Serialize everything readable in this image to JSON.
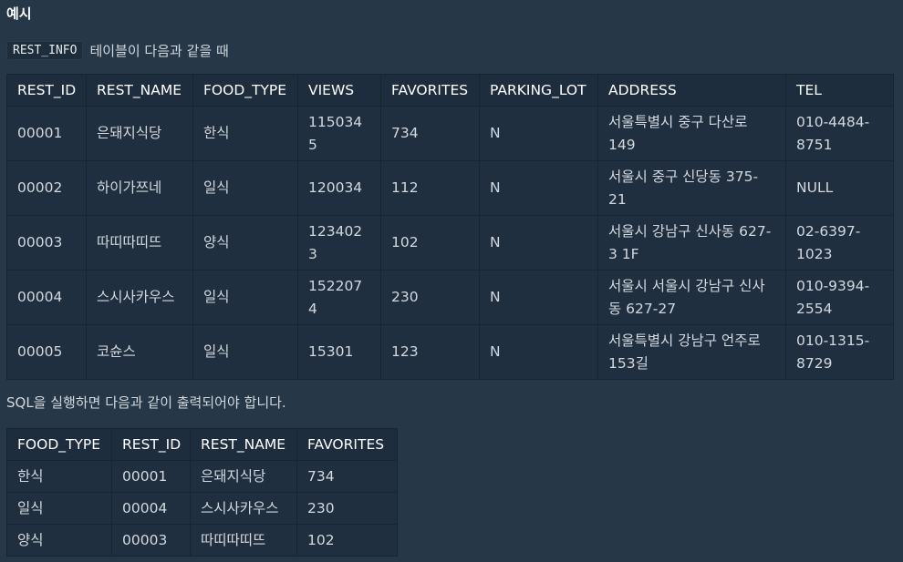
{
  "heading": "예시",
  "intro": {
    "table_name": "REST_INFO",
    "text": "테이블이 다음과 같을 때"
  },
  "table1": {
    "columns": [
      "REST_ID",
      "REST_NAME",
      "FOOD_TYPE",
      "VIEWS",
      "FAVORITES",
      "PARKING_LOT",
      "ADDRESS",
      "TEL"
    ],
    "rows": [
      [
        "00001",
        "은돼지식당",
        "한식",
        "1150345",
        "734",
        "N",
        "서울특별시 중구 다산로 149",
        "010-4484-8751"
      ],
      [
        "00002",
        "하이가쯔네",
        "일식",
        "120034",
        "112",
        "N",
        "서울시 중구 신당동 375-21",
        "NULL"
      ],
      [
        "00003",
        "따띠따띠뜨",
        "양식",
        "1234023",
        "102",
        "N",
        "서울시 강남구 신사동 627-3 1F",
        "02-6397-1023"
      ],
      [
        "00004",
        "스시사카우스",
        "일식",
        "1522074",
        "230",
        "N",
        "서울시 서울시 강남구 신사동 627-27",
        "010-9394-2554"
      ],
      [
        "00005",
        "코슌스",
        "일식",
        "15301",
        "123",
        "N",
        "서울특별시 강남구 언주로 153길",
        "010-1315-8729"
      ]
    ]
  },
  "result_text": "SQL을 실행하면 다음과 같이 출력되어야 합니다.",
  "table2": {
    "columns": [
      "FOOD_TYPE",
      "REST_ID",
      "REST_NAME",
      "FAVORITES"
    ],
    "rows": [
      [
        "한식",
        "00001",
        "은돼지식당",
        "734"
      ],
      [
        "일식",
        "00004",
        "스시사카우스",
        "230"
      ],
      [
        "양식",
        "00003",
        "따띠따띠뜨",
        "102"
      ]
    ]
  }
}
